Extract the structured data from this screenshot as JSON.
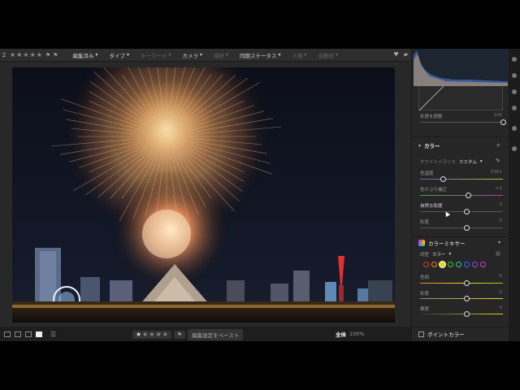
{
  "topbar": {
    "photo_number": "2",
    "filters": [
      {
        "label": "編集済み",
        "dim": false
      },
      {
        "label": "タイプ",
        "dim": false
      },
      {
        "label": "キーワード",
        "dim": true
      },
      {
        "label": "カメラ",
        "dim": false
      },
      {
        "label": "場所",
        "dim": true
      },
      {
        "label": "同期ステータス",
        "dim": false
      },
      {
        "label": "人物",
        "dim": true
      },
      {
        "label": "自動修",
        "dim": true
      }
    ],
    "star_glyph": "★",
    "flag_glyph": "⚑"
  },
  "bottombar": {
    "paste_label": "編集設定をペースト",
    "zoom_label": "全体",
    "zoom_value": "100%",
    "rating": 1
  },
  "panel": {
    "tone_curve": {
      "refine_label": "彩度を調整",
      "refine_value": "100"
    },
    "color": {
      "title": "カラー",
      "wb_label": "ホワイトバランス",
      "wb_value": "カスタム",
      "temp_label": "色温度",
      "temp_value": "5361",
      "tint_label": "色かぶり補正",
      "tint_value": "+1",
      "vibrance_label": "自然な彩度",
      "vibrance_value": "0",
      "saturation_label": "彩度",
      "saturation_value": "0",
      "temp_fraction": 0.27,
      "tint_fraction": 0.58,
      "vibrance_fraction": 0.56,
      "saturation_fraction": 0.56
    },
    "mixer": {
      "title": "カラーミキサー",
      "adjust_label": "調整",
      "adjust_value": "カラー",
      "swatch_colors": [
        "#e33a2f",
        "#f08c1c",
        "#e8d61e",
        "#3bc83b",
        "#2fc4b0",
        "#3a6ff0",
        "#8c4ff0",
        "#d63fd6"
      ],
      "active_swatch": 2,
      "hue_label": "色相",
      "hue_value": "0",
      "sat_label": "彩度",
      "sat_value": "0",
      "lum_label": "輝度",
      "lum_value": "0"
    },
    "point_color": {
      "title": "ポイントカラー"
    }
  }
}
